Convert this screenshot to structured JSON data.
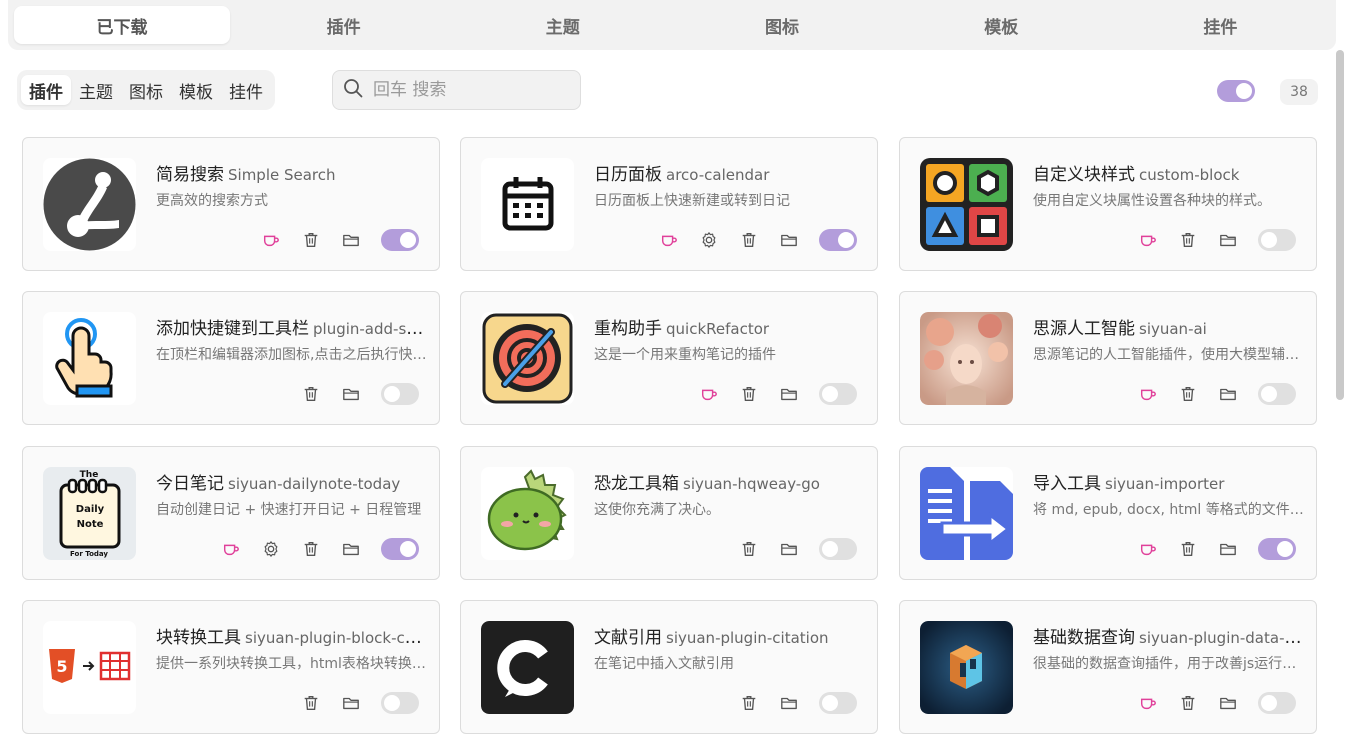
{
  "top_tabs": [
    "已下载",
    "插件",
    "主题",
    "图标",
    "模板",
    "挂件"
  ],
  "segment": [
    "插件",
    "主题",
    "图标",
    "模板",
    "挂件"
  ],
  "search": {
    "placeholder": "回车 搜索"
  },
  "count": "38",
  "colors": {
    "toggle_on": "#b39ddb",
    "sponsor": "#e0409a"
  },
  "cards": [
    {
      "title": "简易搜索",
      "pkg": "Simple Search",
      "desc": "更高效的搜索方式",
      "icon": "simple-search-icon",
      "sponsor": true,
      "settings": false,
      "enabled": true
    },
    {
      "title": "日历面板",
      "pkg": "arco-calendar",
      "desc": "日历面板上快速新建或转到日记",
      "icon": "calendar-icon",
      "sponsor": true,
      "settings": true,
      "enabled": true
    },
    {
      "title": "自定义块样式",
      "pkg": "custom-block",
      "desc": "使用自定义块属性设置各种块的样式。",
      "icon": "custom-block-icon",
      "sponsor": true,
      "settings": false,
      "enabled": false
    },
    {
      "title": "添加快捷键到工具栏",
      "pkg": "plugin-add-shortcut-to-toolbar",
      "desc": "在顶栏和编辑器添加图标,点击之后执行快捷键",
      "icon": "pointer-hand-icon",
      "sponsor": false,
      "settings": false,
      "enabled": false
    },
    {
      "title": "重构助手",
      "pkg": "quickRefactor",
      "desc": "这是一个用来重构笔记的插件",
      "icon": "refactor-gear-icon",
      "sponsor": true,
      "settings": false,
      "enabled": false
    },
    {
      "title": "思源人工智能",
      "pkg": "siyuan-ai",
      "desc": "思源笔记的人工智能插件，使用大模型辅助写作",
      "icon": "ai-portrait-icon",
      "sponsor": true,
      "settings": false,
      "enabled": false
    },
    {
      "title": "今日笔记",
      "pkg": "siyuan-dailynote-today",
      "desc": "自动创建日记 + 快速打开日记 + 日程管理",
      "icon": "daily-note-icon",
      "icon_text": [
        "The",
        "Daily",
        "Note",
        "For Today"
      ],
      "sponsor": true,
      "settings": true,
      "enabled": true
    },
    {
      "title": "恐龙工具箱",
      "pkg": "siyuan-hqweay-go",
      "desc": "这使你充满了决心。",
      "icon": "dinosaur-icon",
      "sponsor": false,
      "settings": false,
      "enabled": false
    },
    {
      "title": "导入工具",
      "pkg": "siyuan-importer",
      "desc": "将 md, epub, docx, html 等格式的文件导入思源",
      "icon": "importer-icon",
      "sponsor": true,
      "settings": false,
      "enabled": true
    },
    {
      "title": "块转换工具",
      "pkg": "siyuan-plugin-block-converter",
      "desc": "提供一系列块转换工具，html表格块转换为表格",
      "icon": "html5-table-icon",
      "sponsor": false,
      "settings": false,
      "enabled": false
    },
    {
      "title": "文献引用",
      "pkg": "siyuan-plugin-citation",
      "desc": "在笔记中插入文献引用",
      "icon": "citation-icon",
      "sponsor": false,
      "settings": false,
      "enabled": false
    },
    {
      "title": "基础数据查询",
      "pkg": "siyuan-plugin-data-query",
      "desc": "很基础的数据查询插件，用于改善js运行体验",
      "icon": "data-query-icon",
      "sponsor": true,
      "settings": false,
      "enabled": false
    }
  ]
}
